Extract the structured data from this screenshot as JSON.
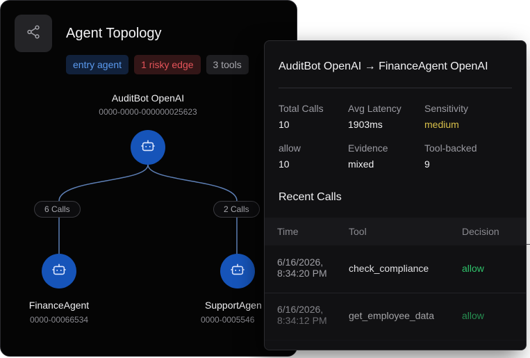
{
  "header": {
    "title": "Agent Topology",
    "icon": "share-icon",
    "chips": [
      "entry agent",
      "1 risky edge",
      "3 tools"
    ]
  },
  "nodes": [
    {
      "name": "AuditBot OpenAI",
      "id": "0000-0000-000000025623"
    },
    {
      "name": "FinanceAgent",
      "id": "0000-00066534"
    },
    {
      "name": "SupportAgen",
      "id": "0000-0005546"
    }
  ],
  "edges": [
    {
      "label": "6 Calls"
    },
    {
      "label": "2 Calls"
    }
  ],
  "detail": {
    "title": "AuditBot OpenAI → FinanceAgent OpenAI",
    "stats": [
      {
        "label": "Total Calls",
        "value": "10"
      },
      {
        "label": "Avg Latency",
        "value": "1903ms"
      },
      {
        "label": "Sensitivity",
        "value": "medium"
      },
      {
        "label": "allow",
        "value": "10"
      },
      {
        "label": "Evidence",
        "value": "mixed"
      },
      {
        "label": "Tool-backed",
        "value": "9"
      }
    ],
    "recent_title": "Recent Calls",
    "columns": [
      "Time",
      "Tool",
      "Decision"
    ],
    "rows": [
      {
        "time": "6/16/2026, 8:34:20 PM",
        "tool": "check_compliance",
        "decision": "allow"
      },
      {
        "time": "6/16/2026, 8:34:12 PM",
        "tool": "get_employee_data",
        "decision": "allow"
      }
    ]
  },
  "colors": {
    "node": "#1654b9",
    "allow": "#2fc26a",
    "sensitivity_medium": "#d8c04a",
    "risky": "#e5545a"
  }
}
